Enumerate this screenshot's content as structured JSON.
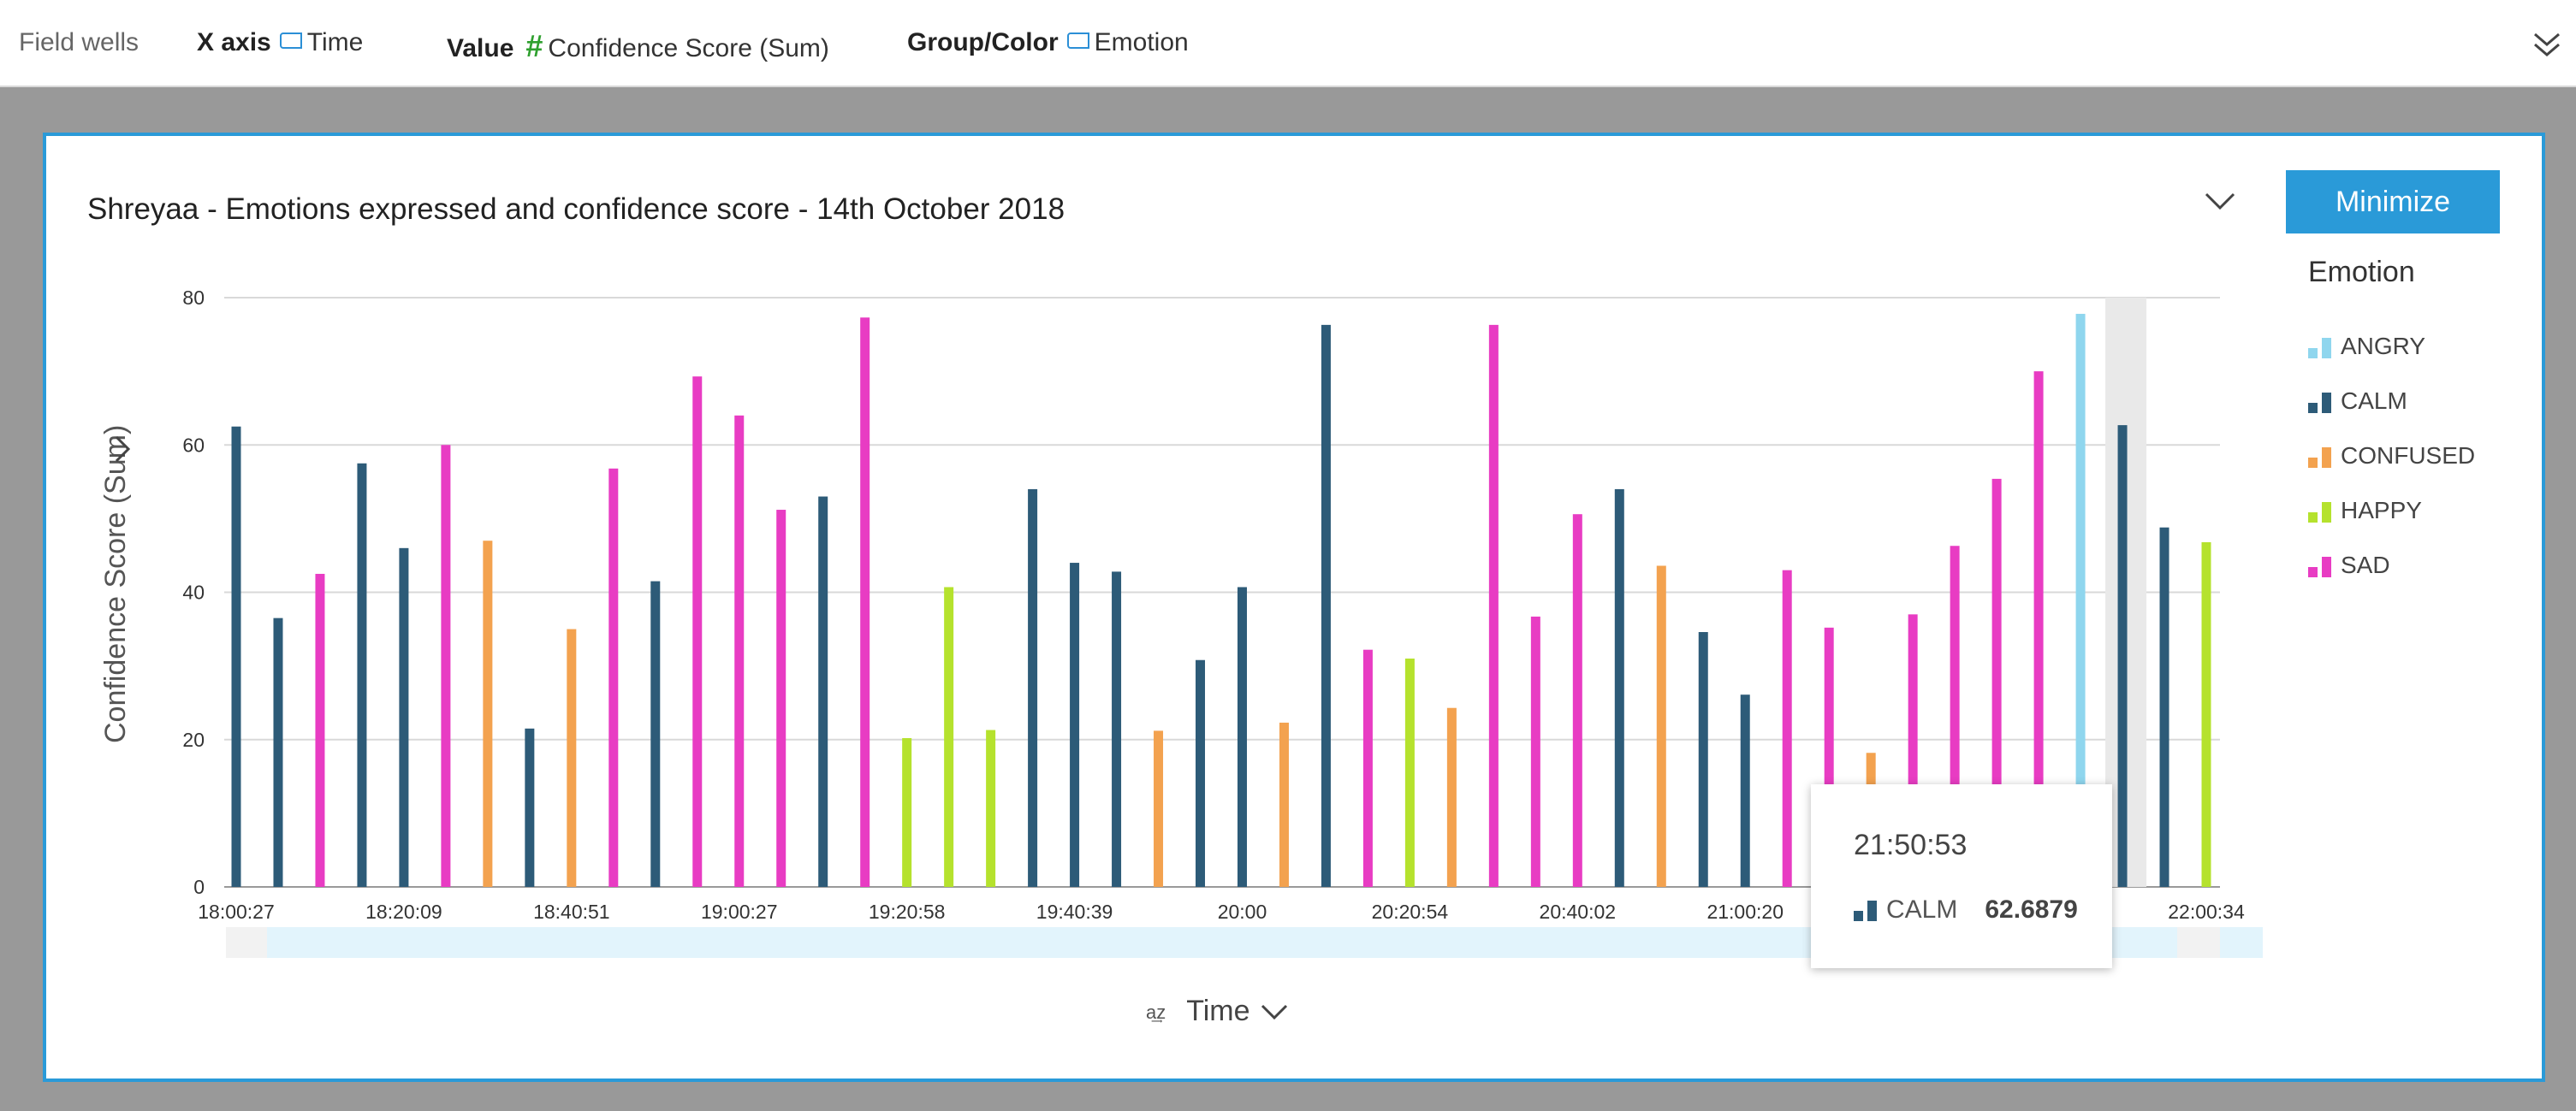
{
  "fieldwells": {
    "label": "Field wells",
    "xaxis_key": "X axis",
    "xaxis_field": "Time",
    "value_key": "Value",
    "value_field": "Confidence Score (Sum)",
    "group_key": "Group/Color",
    "group_field": "Emotion",
    "expand_icon": "double-chevron-down-icon"
  },
  "panel": {
    "title": "Shreyaa - Emotions expressed and confidence score - 14th October 2018",
    "menu_icon": "chevron-down-icon",
    "minimize_label": "Minimize"
  },
  "legend": {
    "title": "Emotion",
    "items": [
      {
        "label": "ANGRY",
        "color": "#8fd6ee"
      },
      {
        "label": "CALM",
        "color": "#2d5b78"
      },
      {
        "label": "CONFUSED",
        "color": "#f3a24f"
      },
      {
        "label": "HAPPY",
        "color": "#b5e22d"
      },
      {
        "label": "SAD",
        "color": "#e83cc3"
      }
    ]
  },
  "axis": {
    "y_title": "Confidence Score (Sum)",
    "x_title": "Time",
    "x_sort_icon": "sort-az-icon",
    "x_menu_icon": "chevron-down-icon",
    "y_menu_icon": "chevron-right-icon"
  },
  "tooltip": {
    "time": "21:50:53",
    "series": "CALM",
    "value": "62.6879",
    "icon": "bar-chart-icon"
  },
  "chart_data": {
    "type": "bar",
    "title": "Shreyaa - Emotions expressed and confidence score - 14th October 2018",
    "xlabel": "Time",
    "ylabel": "Confidence Score (Sum)",
    "ylim": [
      0,
      80
    ],
    "yticks": [
      0,
      20,
      40,
      60,
      80
    ],
    "grid": true,
    "legend_position": "right",
    "x_tick_labels": [
      "18:00:27",
      "18:20:09",
      "18:40:51",
      "19:00:27",
      "19:20:58",
      "19:40:39",
      "20:00",
      "20:20:54",
      "20:40:02",
      "21:00:20",
      "22:00:34"
    ],
    "highlighted_category": "21:50:53",
    "bars": [
      {
        "emotion": "CALM",
        "value": 62.5
      },
      {
        "emotion": "CALM",
        "value": 36.5
      },
      {
        "emotion": "SAD",
        "value": 42.5
      },
      {
        "emotion": "CALM",
        "value": 57.5
      },
      {
        "emotion": "CALM",
        "value": 46
      },
      {
        "emotion": "SAD",
        "value": 60
      },
      {
        "emotion": "CONFUSED",
        "value": 47
      },
      {
        "emotion": "CALM",
        "value": 21.5
      },
      {
        "emotion": "CONFUSED",
        "value": 35
      },
      {
        "emotion": "SAD",
        "value": 56.8
      },
      {
        "emotion": "CALM",
        "value": 41.5
      },
      {
        "emotion": "SAD",
        "value": 69.3
      },
      {
        "emotion": "SAD",
        "value": 64
      },
      {
        "emotion": "SAD",
        "value": 51.2
      },
      {
        "emotion": "CALM",
        "value": 53
      },
      {
        "emotion": "SAD",
        "value": 77.3
      },
      {
        "emotion": "HAPPY",
        "value": 20.2
      },
      {
        "emotion": "HAPPY",
        "value": 40.7
      },
      {
        "emotion": "HAPPY",
        "value": 21.3
      },
      {
        "emotion": "CALM",
        "value": 54
      },
      {
        "emotion": "CALM",
        "value": 44
      },
      {
        "emotion": "CALM",
        "value": 42.8
      },
      {
        "emotion": "CONFUSED",
        "value": 21.2
      },
      {
        "emotion": "CALM",
        "value": 30.8
      },
      {
        "emotion": "CALM",
        "value": 40.7
      },
      {
        "emotion": "CONFUSED",
        "value": 22.3
      },
      {
        "emotion": "CALM",
        "value": 76.3
      },
      {
        "emotion": "SAD",
        "value": 32.2
      },
      {
        "emotion": "HAPPY",
        "value": 31
      },
      {
        "emotion": "CONFUSED",
        "value": 24.3
      },
      {
        "emotion": "SAD",
        "value": 76.3
      },
      {
        "emotion": "SAD",
        "value": 36.7
      },
      {
        "emotion": "SAD",
        "value": 50.6
      },
      {
        "emotion": "CALM",
        "value": 54
      },
      {
        "emotion": "CONFUSED",
        "value": 43.6
      },
      {
        "emotion": "CALM",
        "value": 34.6
      },
      {
        "emotion": "CALM",
        "value": 26.1
      },
      {
        "emotion": "SAD",
        "value": 43
      },
      {
        "emotion": "SAD",
        "value": 35.2
      },
      {
        "emotion": "CONFUSED",
        "value": 18.2
      },
      {
        "emotion": "SAD",
        "value": 37
      },
      {
        "emotion": "SAD",
        "value": 46.3
      },
      {
        "emotion": "SAD",
        "value": 55.4
      },
      {
        "emotion": "SAD",
        "value": 70
      },
      {
        "emotion": "ANGRY",
        "value": 77.8
      },
      {
        "emotion": "CALM",
        "value": 62.6879
      },
      {
        "emotion": "CALM",
        "value": 48.8
      },
      {
        "emotion": "HAPPY",
        "value": 46.8
      }
    ]
  }
}
